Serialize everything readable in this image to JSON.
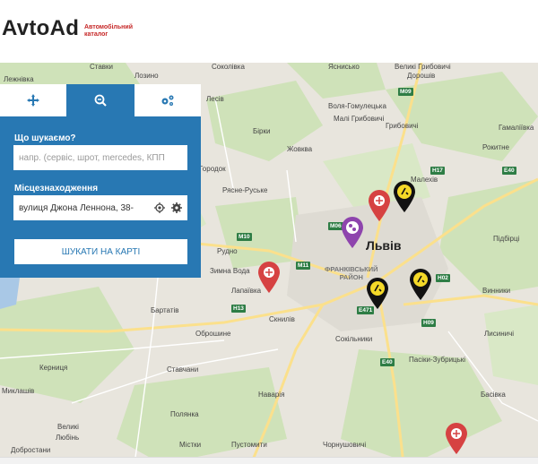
{
  "brand": {
    "name": "AvtoAd",
    "tagline_line1": "Автомобільний",
    "tagline_line2": "каталог",
    "accent": "#c62828"
  },
  "panel": {
    "bg_color": "#2878b3",
    "tabs": [
      {
        "name": "move-icon",
        "active": false
      },
      {
        "name": "zoom-search-icon",
        "active": true
      },
      {
        "name": "settings-icon",
        "active": false
      }
    ],
    "what_label": "Що шукаємо?",
    "what_placeholder": "напр. (сервіс, шрот, mercedes, КПП",
    "location_label": "Місцезнаходження",
    "location_value": "вулиця Джона Леннона, 38-",
    "search_button": "ШУКАТИ НА КАРТІ"
  },
  "map": {
    "places": {
      "lviv": "Львів",
      "lezhivka": "Лежнівка",
      "stavky": "Ставки",
      "lozino": "Лозино",
      "sokolivka": "Соколівка",
      "yasnyska": "Яснисько",
      "velyki_hrybovychi": "Великі Грибовичі",
      "dorosh": "Дорошів",
      "lesiv": "Лесів",
      "volia": "Воля-Гомулецька",
      "mali_hrybovychi": "Малі Грибовичі",
      "hrybovychi": "Грибовичі",
      "birky": "Бірки",
      "zhovkva": "Жовква",
      "hamaliivka": "Гамаліївка",
      "rokytne": "Рокитне",
      "malekhiv": "Малехів",
      "horodok": "Городок",
      "yasne": "Рясне-Руське",
      "pidhirtsi": "Підбірці",
      "rudno": "Рудно",
      "zymna_voda": "Зимна Вода",
      "lapaivka": "Лапаївка",
      "sknyliv": "Скнилів",
      "dist_line1": "ФРАНКІВСЬКИЙ",
      "dist_line2": "РАЙОН",
      "vynnyky": "Винники",
      "bartativ": "Бартатів",
      "obroshyne": "Оброшине",
      "sokilnyky": "Сокільники",
      "lysynychi": "Лисиничі",
      "mykolaiv": "Миклашів",
      "kernytsia": "Керниця",
      "stavchany": "Ставчани",
      "pasiky": "Пасіки-Зубрицькі",
      "basivka": "Басівка",
      "navaria": "Наварія",
      "velykyi": "Великі",
      "liubin": "Любінь",
      "polianka": "Полянка",
      "pustomyty": "Пустомити",
      "mistky": "Містки",
      "dobrostany": "Добростани",
      "chornushovychi": "Чорнушовичі"
    },
    "roads": [
      "M09",
      "M10",
      "M11",
      "H13",
      "H17",
      "E40",
      "E471",
      "H02",
      "H09",
      "M06",
      "E40"
    ],
    "pins": [
      {
        "name": "red-pin-sknyliv",
        "type": "service",
        "color": "#d64242"
      },
      {
        "name": "red-pin-north",
        "type": "service",
        "color": "#d64242"
      },
      {
        "name": "red-pin-south",
        "type": "service",
        "color": "#d64242"
      },
      {
        "name": "purple-pin-center",
        "type": "parts",
        "color": "#8e44ad"
      },
      {
        "name": "yellow-pin-north",
        "type": "dealer",
        "color": "#f4d928"
      },
      {
        "name": "yellow-pin-east",
        "type": "dealer",
        "color": "#f4d928"
      },
      {
        "name": "yellow-pin-center",
        "type": "dealer",
        "color": "#f4d928"
      }
    ]
  }
}
